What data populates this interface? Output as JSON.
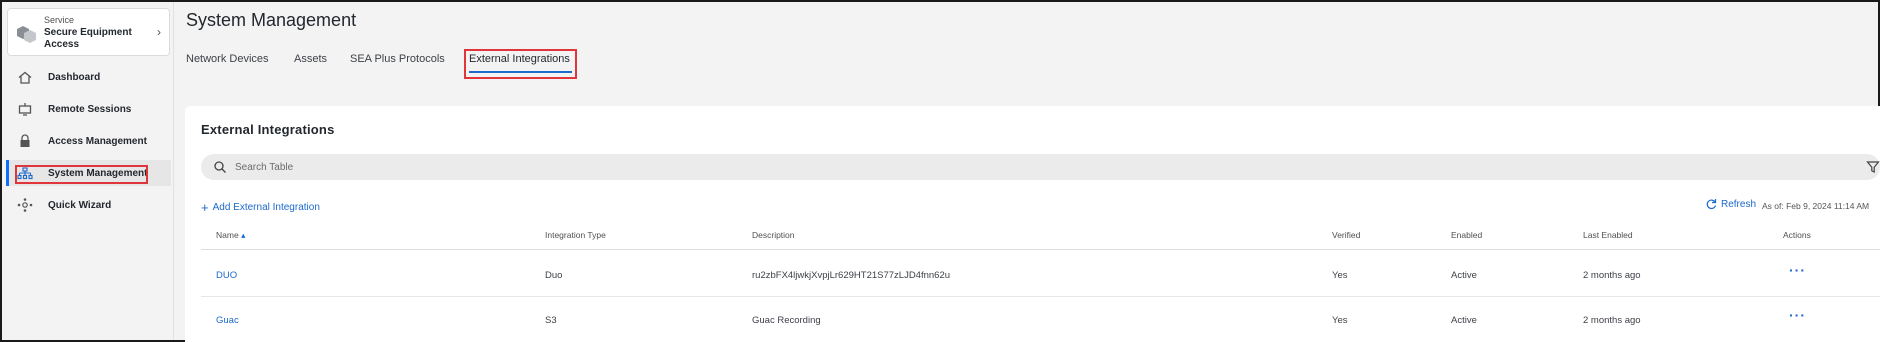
{
  "sidebar": {
    "app": {
      "service_label": "Service",
      "name": "Secure Equipment Access",
      "chevron": "›"
    },
    "items": [
      {
        "label": "Dashboard",
        "icon": "home-icon"
      },
      {
        "label": "Remote Sessions",
        "icon": "monitor-icon"
      },
      {
        "label": "Access Management",
        "icon": "lock-icon"
      },
      {
        "label": "System Management",
        "icon": "sitemap-icon",
        "active": true
      },
      {
        "label": "Quick Wizard",
        "icon": "wizard-icon"
      }
    ]
  },
  "header": {
    "title": "System Management",
    "tabs": [
      {
        "label": "Network Devices"
      },
      {
        "label": "Assets"
      },
      {
        "label": "SEA Plus Protocols"
      },
      {
        "label": "External Integrations",
        "active": true
      }
    ]
  },
  "card": {
    "title": "External Integrations",
    "search_placeholder": "Search Table",
    "add_label": "Add External Integration",
    "refresh_label": "Refresh",
    "as_of": "As of: Feb 9, 2024 11:14 AM"
  },
  "table": {
    "columns": [
      "Name",
      "Integration Type",
      "Description",
      "Verified",
      "Enabled",
      "Last Enabled",
      "Actions"
    ],
    "sort_indicator": "▴",
    "rows": [
      {
        "name": "DUO",
        "type": "Duo",
        "description": "ru2zbFX4ljwkjXvpjLr629HT21S77zLJD4fnn62u",
        "verified": "Yes",
        "enabled": "Active",
        "last_enabled": "2 months ago",
        "actions": "···"
      },
      {
        "name": "Guac",
        "type": "S3",
        "description": "Guac Recording",
        "verified": "Yes",
        "enabled": "Active",
        "last_enabled": "2 months ago",
        "actions": "···"
      }
    ]
  },
  "colors": {
    "accent": "#1d69cc",
    "highlight": "#e0353b",
    "background": "#f3f3f3"
  }
}
